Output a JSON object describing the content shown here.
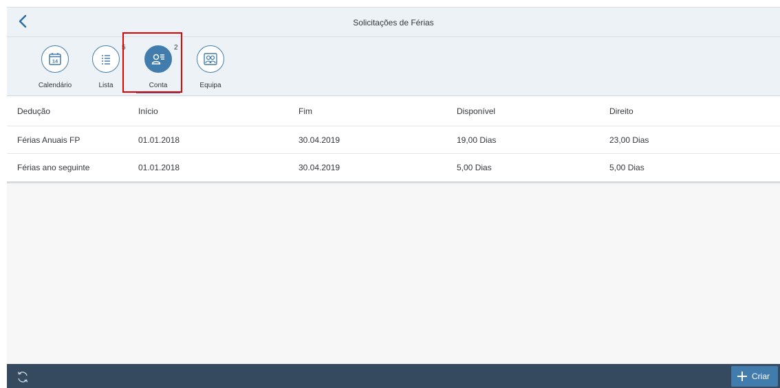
{
  "header": {
    "title": "Solicitações de Férias",
    "back_icon": "chevron-left-icon"
  },
  "tabs": [
    {
      "label": "Calendário",
      "icon": "calendar-icon",
      "icon_text": "14",
      "count": "",
      "selected": false
    },
    {
      "label": "Lista",
      "icon": "list-icon",
      "count": "5",
      "selected": false
    },
    {
      "label": "Conta",
      "icon": "account-icon",
      "count": "2",
      "selected": true
    },
    {
      "label": "Equipa",
      "icon": "team-icon",
      "count": "",
      "selected": false
    }
  ],
  "table": {
    "columns": [
      "Dedução",
      "Início",
      "Fim",
      "Disponível",
      "Direito"
    ],
    "rows": [
      [
        "Férias Anuais FP",
        "01.01.2018",
        "30.04.2019",
        "19,00 Dias",
        "23,00 Dias"
      ],
      [
        "Férias ano seguinte",
        "01.01.2018",
        "30.04.2019",
        "5,00 Dias",
        "5,00 Dias"
      ]
    ]
  },
  "footer": {
    "refresh_icon": "refresh-icon",
    "create_label": "Criar",
    "create_icon": "plus-icon"
  },
  "colors": {
    "accent": "#427cac",
    "header_bg": "#edf2f6",
    "footer_bg": "#354a5f",
    "highlight": "#e30000"
  }
}
